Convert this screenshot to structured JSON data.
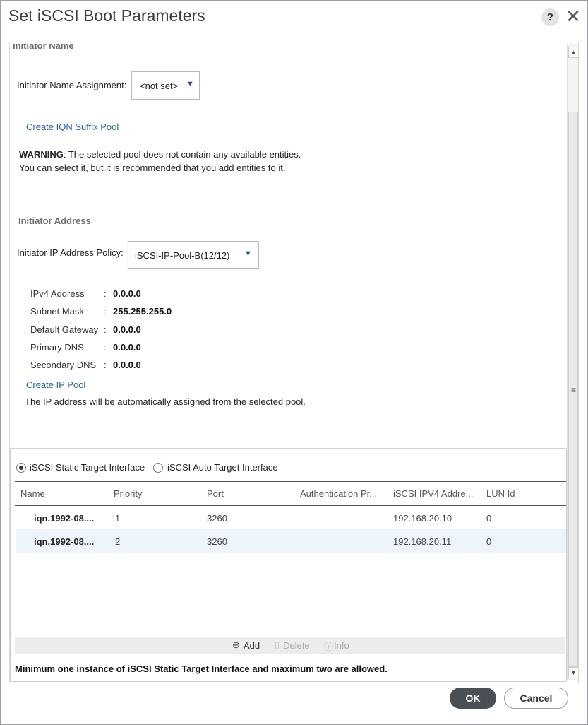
{
  "dialog": {
    "title": "Set iSCSI Boot Parameters",
    "help_icon": "?",
    "close_icon": "✕"
  },
  "initiator_name": {
    "section_title": "Initiator Name",
    "assignment_label": "Initiator Name Assignment:",
    "assignment_value": "<not set>",
    "create_pool_link": "Create IQN Suffix Pool",
    "warning_bold": "WARNING",
    "warning_line1": ": The selected pool does not contain any available entities.",
    "warning_line2": "You can select it, but it is recommended that you add entities to it."
  },
  "initiator_address": {
    "section_title": "Initiator Address",
    "policy_label": "Initiator IP Address Policy:",
    "policy_value": "iSCSI-IP-Pool-B(12/12)",
    "fields": [
      {
        "key": "IPv4 Address",
        "value": "0.0.0.0"
      },
      {
        "key": "Subnet Mask",
        "value": "255.255.255.0"
      },
      {
        "key": "Default Gateway",
        "value": "0.0.0.0"
      },
      {
        "key": "Primary DNS",
        "value": "0.0.0.0"
      },
      {
        "key": "Secondary DNS",
        "value": "0.0.0.0"
      }
    ],
    "create_ip_pool_link": "Create IP Pool",
    "auto_assign_note": "The IP address will be automatically assigned from the selected pool."
  },
  "target_interface": {
    "static_option": "iSCSI Static Target Interface",
    "auto_option": "iSCSI Auto Target Interface",
    "selected": "static",
    "columns": [
      "Name",
      "Priority",
      "Port",
      "Authentication Pr...",
      "iSCSI IPV4 Addre...",
      "LUN Id"
    ],
    "rows": [
      {
        "name": "iqn.1992-08....",
        "priority": "1",
        "port": "3260",
        "auth": "",
        "ip": "192.168.20.10",
        "lun": "0"
      },
      {
        "name": "iqn.1992-08....",
        "priority": "2",
        "port": "3260",
        "auth": "",
        "ip": "192.168.20.11",
        "lun": "0"
      }
    ],
    "toolbar": {
      "add_label": "Add",
      "delete_label": "Delete",
      "info_label": "Info"
    },
    "footnote": "Minimum one instance of iSCSI Static Target Interface and maximum two are allowed."
  },
  "buttons": {
    "ok": "OK",
    "cancel": "Cancel"
  },
  "colors": {
    "link": "#2f5f8f",
    "ok_button": "#4a4f55",
    "selected_row": "#eef4fb"
  }
}
